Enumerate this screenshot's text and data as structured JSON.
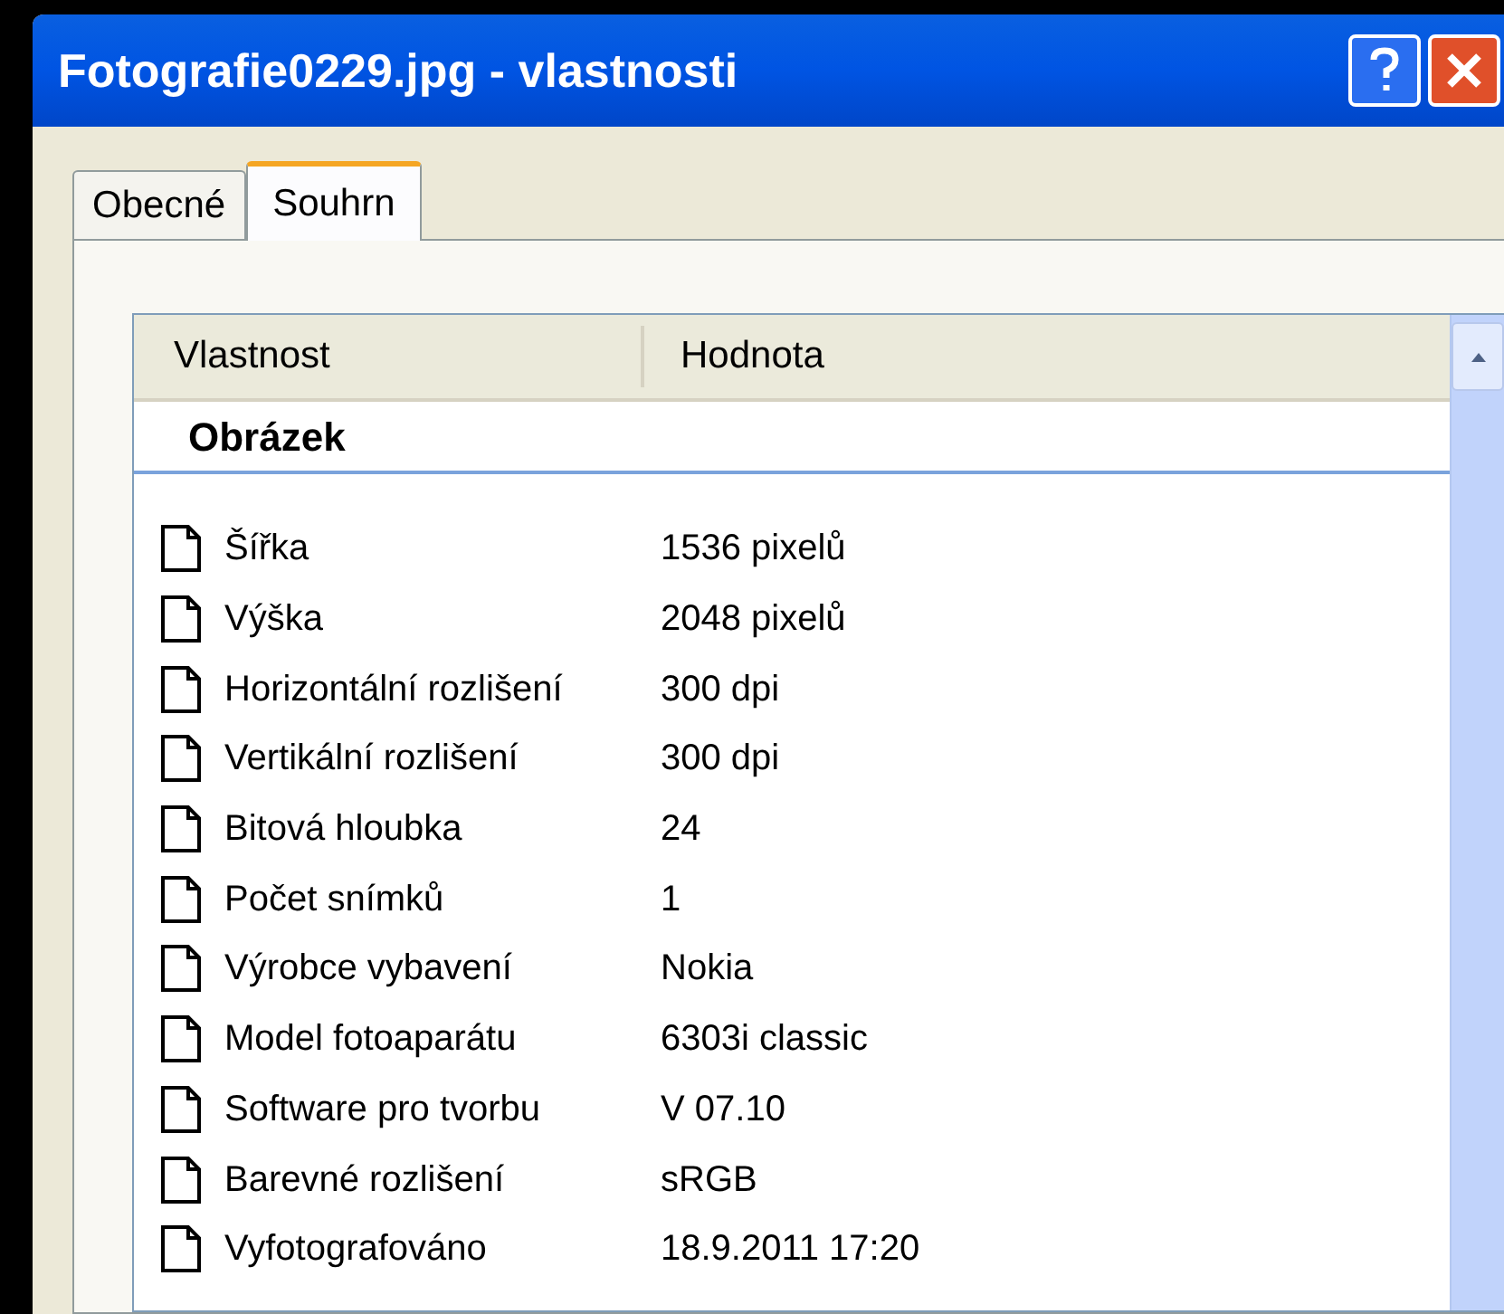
{
  "window": {
    "title": "Fotografie0229.jpg - vlastnosti"
  },
  "tabs": [
    {
      "label": "Obecné",
      "selected": false
    },
    {
      "label": "Souhrn",
      "selected": true
    }
  ],
  "list": {
    "columns": [
      "Vlastnost",
      "Hodnota"
    ],
    "group": "Obrázek",
    "rows": [
      {
        "property": "Šířka",
        "value": "1536 pixelů"
      },
      {
        "property": "Výška",
        "value": "2048 pixelů"
      },
      {
        "property": "Horizontální rozlišení",
        "value": "300 dpi"
      },
      {
        "property": "Vertikální rozlišení",
        "value": "300 dpi"
      },
      {
        "property": "Bitová hloubka",
        "value": "24"
      },
      {
        "property": "Počet snímků",
        "value": "1"
      },
      {
        "property": "Výrobce vybavení",
        "value": "Nokia"
      },
      {
        "property": "Model fotoaparátu",
        "value": "6303i classic"
      },
      {
        "property": "Software pro tvorbu",
        "value": "V 07.10"
      },
      {
        "property": "Barevné rozlišení",
        "value": "sRGB"
      },
      {
        "property": "Vyfotografováno",
        "value": "18.9.2011 17:20"
      }
    ]
  }
}
